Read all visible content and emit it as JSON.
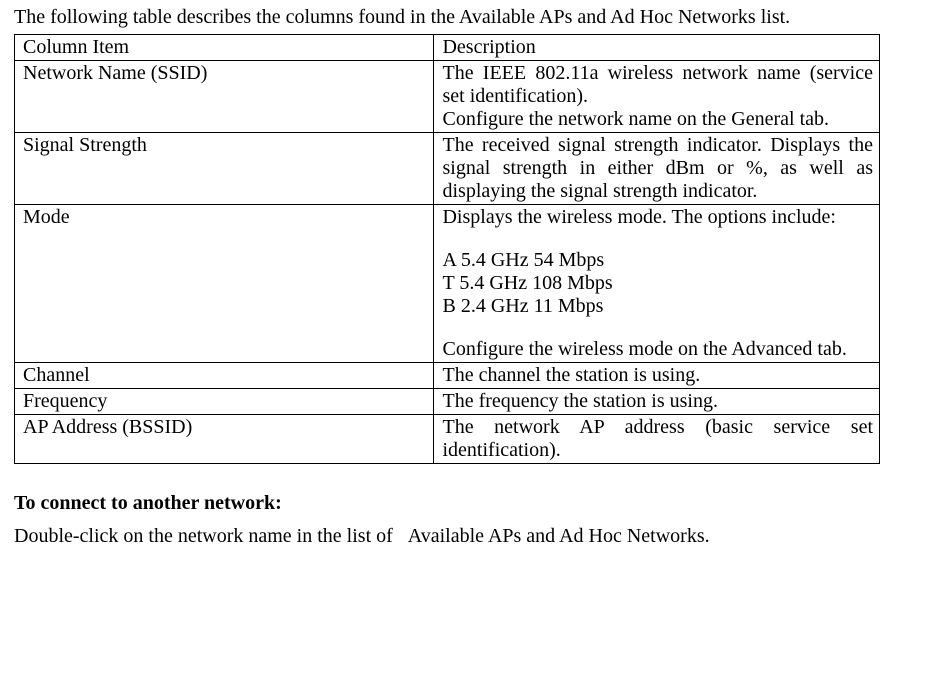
{
  "intro": "The following table describes the columns found in the Available APs and Ad Hoc Networks list.",
  "header": {
    "col1": "Column Item",
    "col2": "Description"
  },
  "rows": {
    "ssid": {
      "item": "Network Name (SSID)",
      "p1": "The IEEE 802.11a wireless network name (service set identification).",
      "p2": "Configure the network name on the General tab."
    },
    "signal": {
      "item": "Signal Strength",
      "p1": "The received signal strength indicator. Displays the signal strength in either dBm or %, as well as displaying the signal strength indicator."
    },
    "mode": {
      "item": "Mode",
      "p1": "Displays the wireless mode. The options include:",
      "opt1": "A 5.4 GHz 54 Mbps",
      "opt2": "T 5.4 GHz 108 Mbps",
      "opt3": "B 2.4 GHz 11 Mbps",
      "p2": "Configure the wireless mode on the Advanced tab."
    },
    "channel": {
      "item": "Channel",
      "p1": "The channel the station is using."
    },
    "frequency": {
      "item": "Frequency",
      "p1": "The frequency the station is using."
    },
    "ap": {
      "item": "AP Address (BSSID)",
      "p1": "The network AP address (basic service set identification)."
    }
  },
  "heading": "To connect to another network:",
  "para": "Double-click on the network name in the list of  Available APs and Ad Hoc Networks."
}
